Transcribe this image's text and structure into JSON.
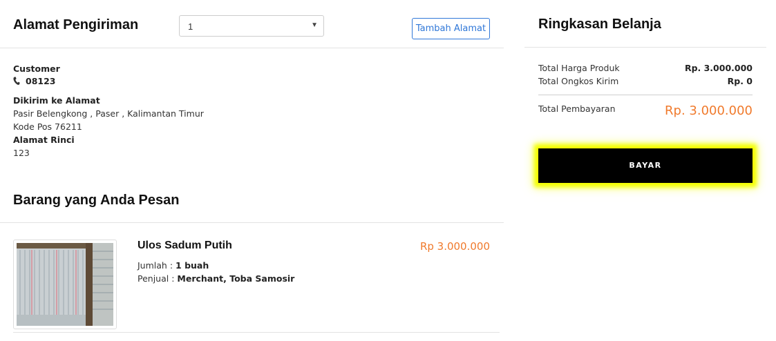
{
  "shipping": {
    "title": "Alamat Pengiriman",
    "address_select_value": "1",
    "add_address_label": "Tambah Alamat",
    "customer_name": "Customer",
    "phone": "08123",
    "sent_to_label": "Dikirim ke Alamat",
    "address_line": "Pasir Belengkong , Paser , Kalimantan Timur",
    "postal_code": "Kode Pos 76211",
    "detail_label": "Alamat Rinci",
    "detail_value": "123"
  },
  "order": {
    "title": "Barang yang Anda Pesan",
    "items": [
      {
        "name": "Ulos Sadum Putih",
        "price": "Rp 3.000.000",
        "qty_label": "Jumlah :",
        "qty_value": "1 buah",
        "seller_label": "Penjual :",
        "seller_value": "Merchant, Toba Samosir",
        "image_icon": "woven-cloth-photo"
      }
    ]
  },
  "summary": {
    "title": "Ringkasan Belanja",
    "product_total_label": "Total Harga Produk",
    "product_total_value": "Rp. 3.000.000",
    "shipping_total_label": "Total Ongkos Kirim",
    "shipping_total_value": "Rp. 0",
    "payment_total_label": "Total Pembayaran",
    "payment_total_value": "Rp. 3.000.000",
    "pay_button_label": "BAYAR"
  },
  "colors": {
    "accent_orange": "#f07a2c",
    "link_blue": "#2f77d8",
    "highlight_yellow": "#f4ff00"
  }
}
